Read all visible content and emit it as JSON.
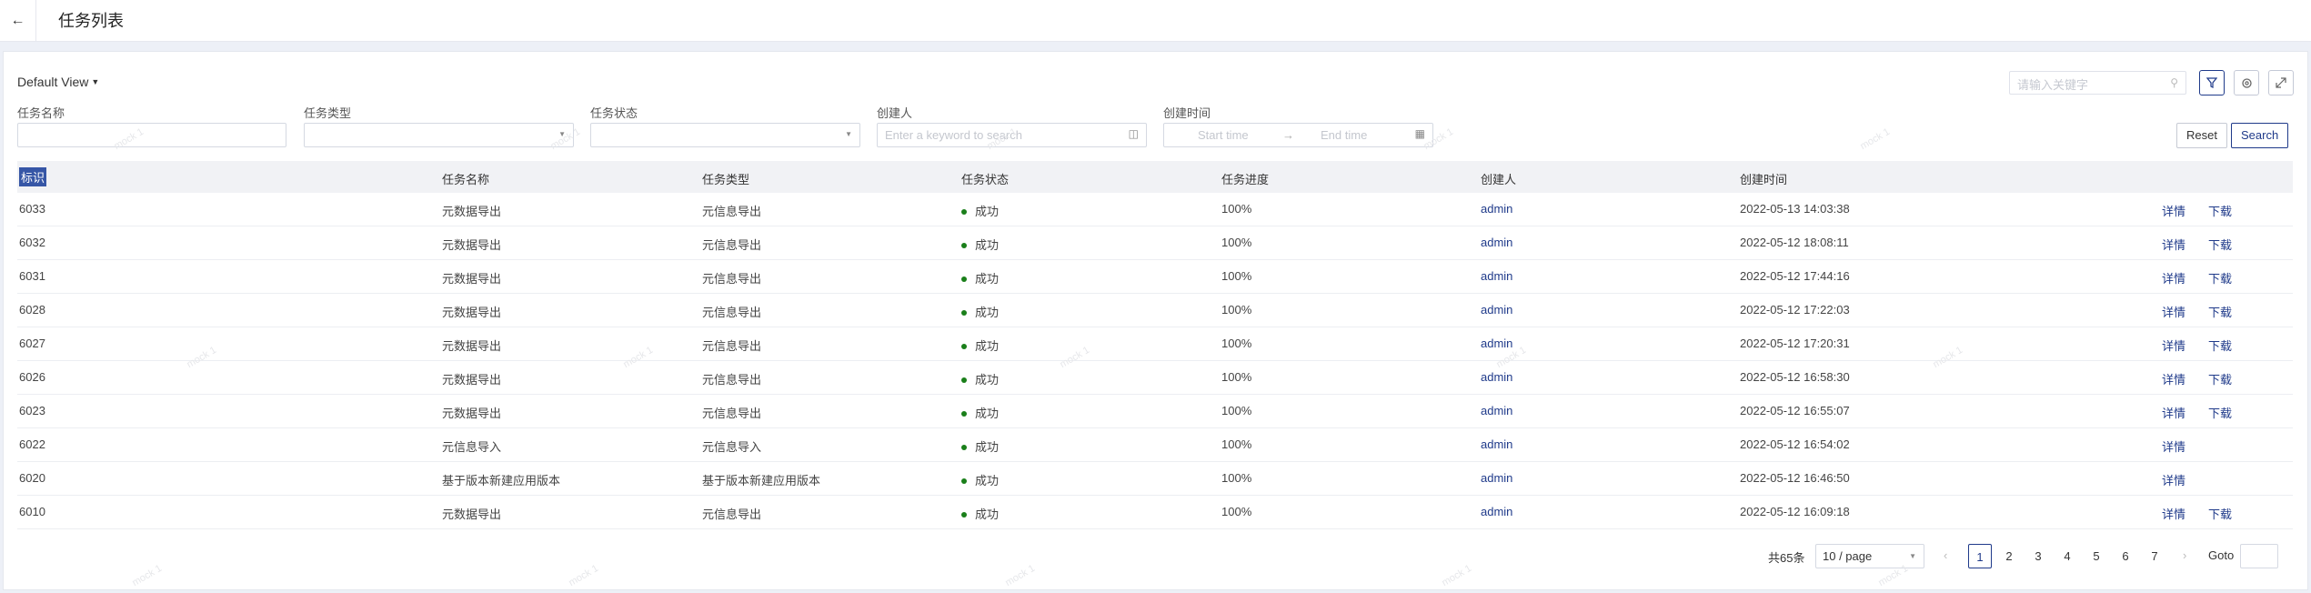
{
  "header": {
    "back_icon": "arrow-left-icon",
    "back_glyph": "←",
    "title": "任务列表"
  },
  "view": {
    "label": "Default View"
  },
  "toolbar": {
    "search_placeholder": "请输入关键字"
  },
  "filters": {
    "name_label": "任务名称",
    "type_label": "任务类型",
    "status_label": "任务状态",
    "creator_label": "创建人",
    "creator_placeholder": "Enter a keyword to search",
    "time_label": "创建时间",
    "start_placeholder": "Start time",
    "end_placeholder": "End time",
    "reset_label": "Reset",
    "search_label": "Search"
  },
  "table": {
    "columns": [
      "标识",
      "任务名称",
      "任务类型",
      "任务状态",
      "任务进度",
      "创建人",
      "创建时间"
    ],
    "rows": [
      {
        "id": "6033",
        "name": "元数据导出",
        "type": "元信息导出",
        "status": "成功",
        "progress": "100%",
        "creator": "admin",
        "time": "2022-05-13 14:03:38",
        "actions": [
          "详情",
          "下载"
        ]
      },
      {
        "id": "6032",
        "name": "元数据导出",
        "type": "元信息导出",
        "status": "成功",
        "progress": "100%",
        "creator": "admin",
        "time": "2022-05-12 18:08:11",
        "actions": [
          "详情",
          "下载"
        ]
      },
      {
        "id": "6031",
        "name": "元数据导出",
        "type": "元信息导出",
        "status": "成功",
        "progress": "100%",
        "creator": "admin",
        "time": "2022-05-12 17:44:16",
        "actions": [
          "详情",
          "下载"
        ]
      },
      {
        "id": "6028",
        "name": "元数据导出",
        "type": "元信息导出",
        "status": "成功",
        "progress": "100%",
        "creator": "admin",
        "time": "2022-05-12 17:22:03",
        "actions": [
          "详情",
          "下载"
        ]
      },
      {
        "id": "6027",
        "name": "元数据导出",
        "type": "元信息导出",
        "status": "成功",
        "progress": "100%",
        "creator": "admin",
        "time": "2022-05-12 17:20:31",
        "actions": [
          "详情",
          "下载"
        ]
      },
      {
        "id": "6026",
        "name": "元数据导出",
        "type": "元信息导出",
        "status": "成功",
        "progress": "100%",
        "creator": "admin",
        "time": "2022-05-12 16:58:30",
        "actions": [
          "详情",
          "下载"
        ]
      },
      {
        "id": "6023",
        "name": "元数据导出",
        "type": "元信息导出",
        "status": "成功",
        "progress": "100%",
        "creator": "admin",
        "time": "2022-05-12 16:55:07",
        "actions": [
          "详情",
          "下载"
        ]
      },
      {
        "id": "6022",
        "name": "元信息导入",
        "type": "元信息导入",
        "status": "成功",
        "progress": "100%",
        "creator": "admin",
        "time": "2022-05-12 16:54:02",
        "actions": [
          "详情"
        ]
      },
      {
        "id": "6020",
        "name": "基于版本新建应用版本",
        "type": "基于版本新建应用版本",
        "status": "成功",
        "progress": "100%",
        "creator": "admin",
        "time": "2022-05-12 16:46:50",
        "actions": [
          "详情"
        ]
      },
      {
        "id": "6010",
        "name": "元数据导出",
        "type": "元信息导出",
        "status": "成功",
        "progress": "100%",
        "creator": "admin",
        "time": "2022-05-12 16:09:18",
        "actions": [
          "详情",
          "下载"
        ]
      }
    ]
  },
  "pagination": {
    "total": "共65条",
    "page_size": "10 / page",
    "pages": [
      "1",
      "2",
      "3",
      "4",
      "5",
      "6",
      "7"
    ],
    "current": "1",
    "goto_label": "Goto"
  },
  "watermark": "mock 1",
  "colors": {
    "primary": "#1f3a8a",
    "success": "#1a7f1a",
    "selection": "#3656a6"
  }
}
